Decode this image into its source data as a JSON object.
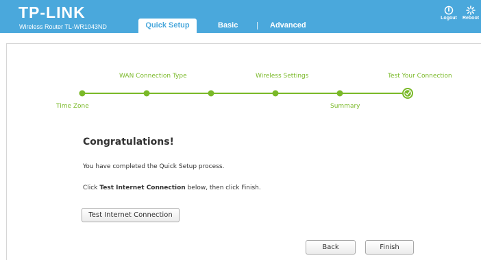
{
  "header": {
    "logo_text": "TP-LINK",
    "model": "Wireless Router TL-WR1043ND",
    "tabs": [
      {
        "label": "Quick Setup",
        "active": true
      },
      {
        "label": "Basic",
        "active": false
      },
      {
        "label": "Advanced",
        "active": false
      }
    ],
    "logout_label": "Logout",
    "reboot_label": "Reboot"
  },
  "progress": {
    "steps_top": [
      "WAN Connection Type",
      "Wireless Settings",
      "Test Your Connection"
    ],
    "steps_bottom": [
      "Time Zone",
      "Summary"
    ],
    "current_step": "Test Your Connection"
  },
  "main": {
    "title": "Congratulations!",
    "line1": "You have completed the Quick Setup process.",
    "line2_prefix": "Click ",
    "line2_bold": "Test Internet Connection",
    "line2_suffix": " below, then click Finish.",
    "test_button": "Test Internet Connection",
    "back_button": "Back",
    "finish_button": "Finish"
  },
  "colors": {
    "header_bg": "#4aa8dc",
    "accent_green": "#7ab928",
    "text": "#333333"
  },
  "icons": {
    "logout": "power-icon",
    "reboot": "reboot-icon",
    "done": "check-icon"
  }
}
